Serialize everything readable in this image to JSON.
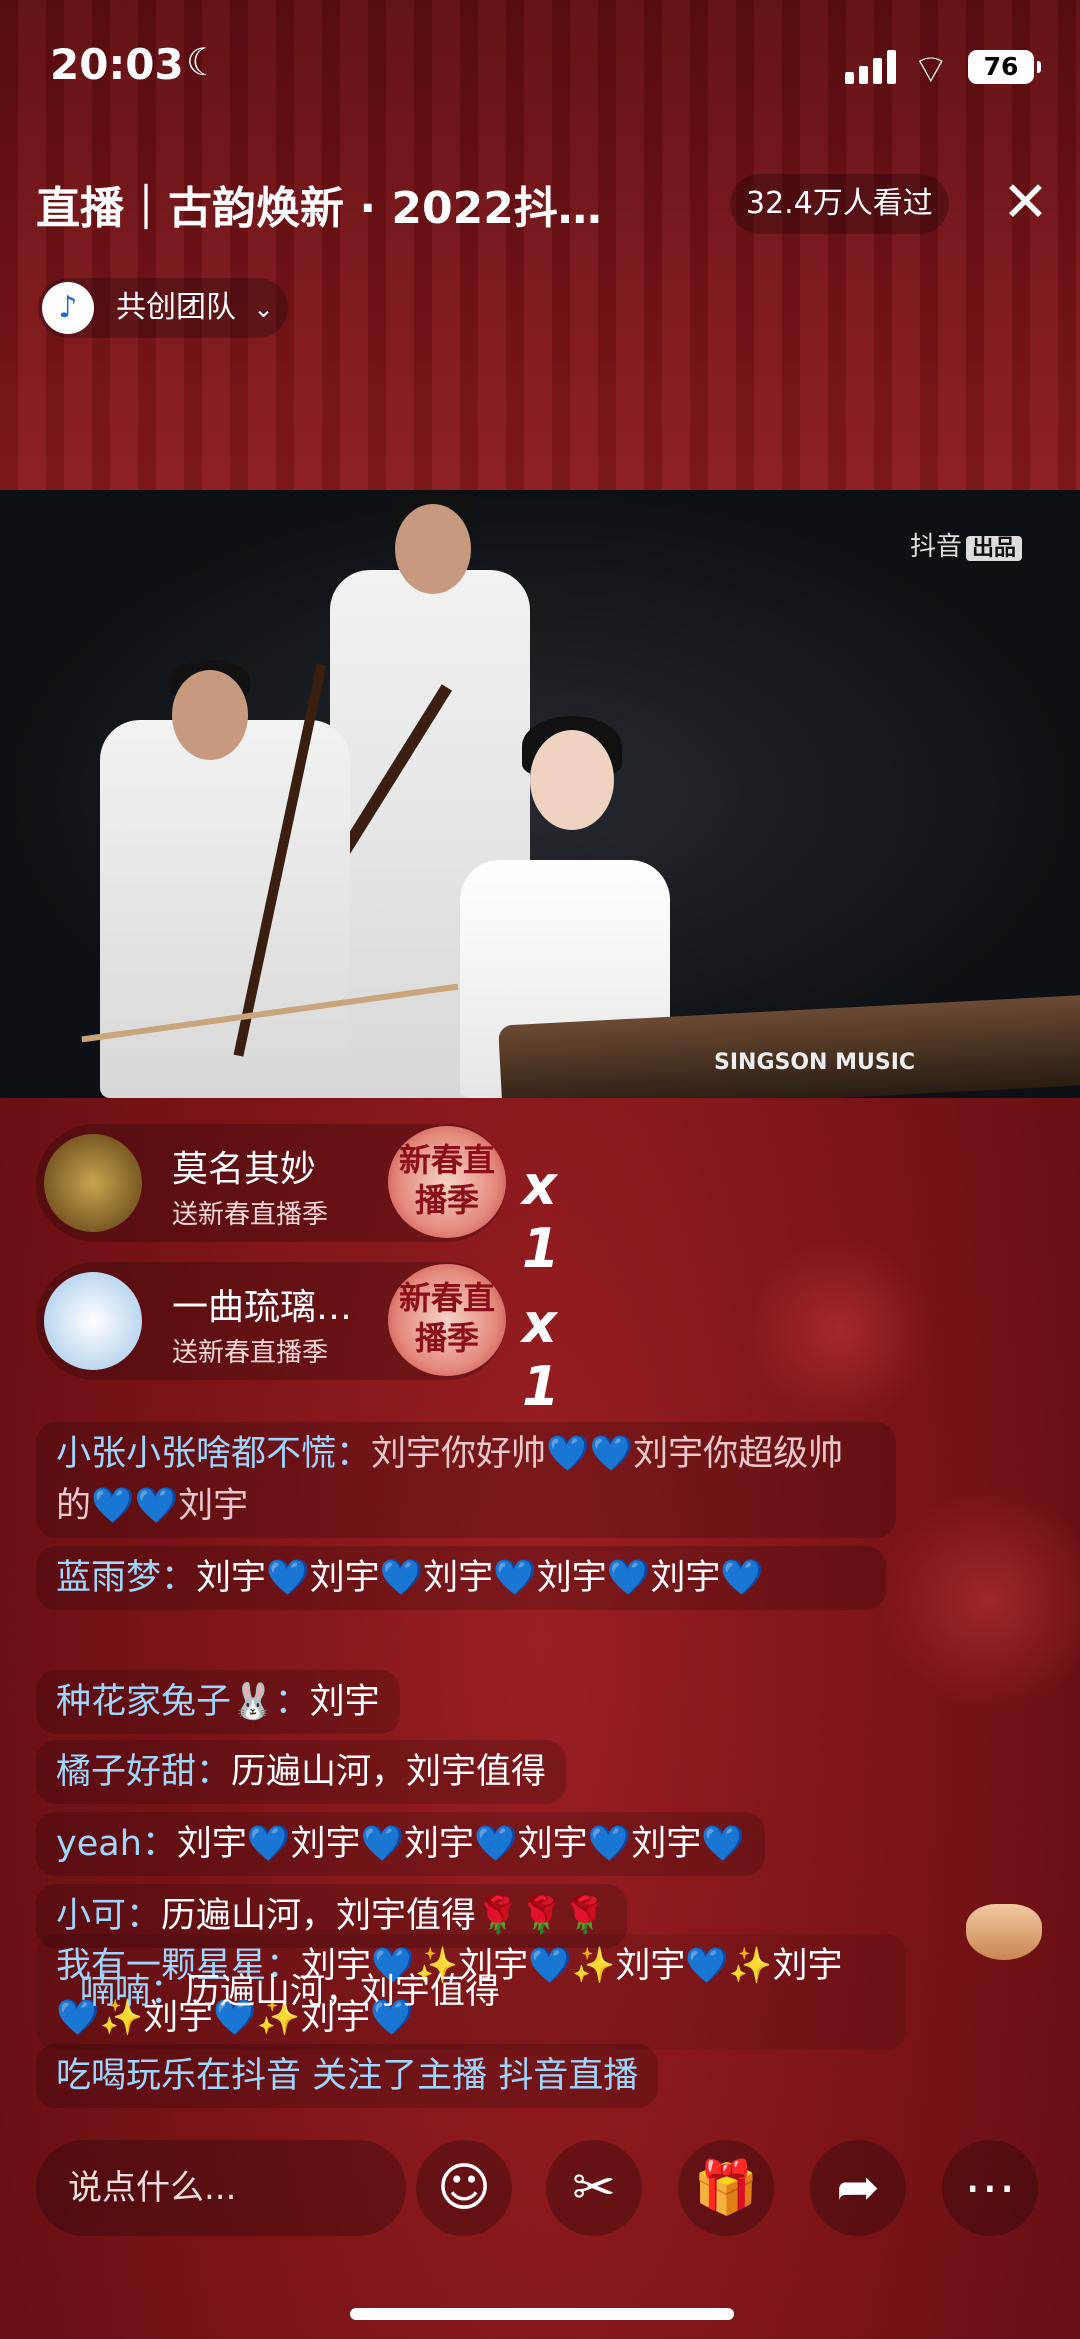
{
  "status_bar": {
    "time": "20:03",
    "battery": "76"
  },
  "header": {
    "title": "直播｜古韵焕新 · 2022抖…",
    "viewers": "32.4万人看过",
    "team_name": "共创团队"
  },
  "video": {
    "watermark": "抖音",
    "watermark_tag": "出品",
    "instrument_brand": "SINGSON MUSIC"
  },
  "gifts": [
    {
      "user": "莫名其妙",
      "action": "送新春直播季",
      "badge": "新春直播季",
      "count": "x 1"
    },
    {
      "user": "一曲琉璃…",
      "action": "送新春直播季",
      "badge": "新春直播季",
      "count": "x 1"
    }
  ],
  "comments": [
    {
      "user": "小张小张啥都不慌：",
      "text": "刘宇你好帅💙💙刘宇你超级帅的💙💙刘宇"
    },
    {
      "user": "蓝雨梦：",
      "text": "刘宇💙刘宇💙刘宇💙刘宇💙刘宇💙"
    },
    {
      "user": "种花家兔子🐰：",
      "text": "刘宇"
    },
    {
      "user": "橘子好甜：",
      "text": "历遍山河，刘宇值得"
    },
    {
      "user": "yeah：",
      "text": "刘宇💙刘宇💙刘宇💙刘宇💙刘宇💙"
    },
    {
      "user": "小可：",
      "text": "历遍山河，刘宇值得🌹🌹🌹"
    },
    {
      "user": "我有一颗星星：",
      "text": "刘宇💙✨刘宇💙✨刘宇💙✨刘宇💙✨刘宇💙✨刘宇💙"
    },
    {
      "user": "喃喃：",
      "text": "历遍山河，刘宇值得"
    },
    {
      "user": "吃喝玩乐在抖音",
      "text": "关注了主播 抖音直播"
    }
  ],
  "bottom_bar": {
    "input_placeholder": "说点什么..."
  },
  "colors": {
    "background": "#7c1418",
    "heart": "#2f7bff",
    "username": "#9fd6ff"
  }
}
